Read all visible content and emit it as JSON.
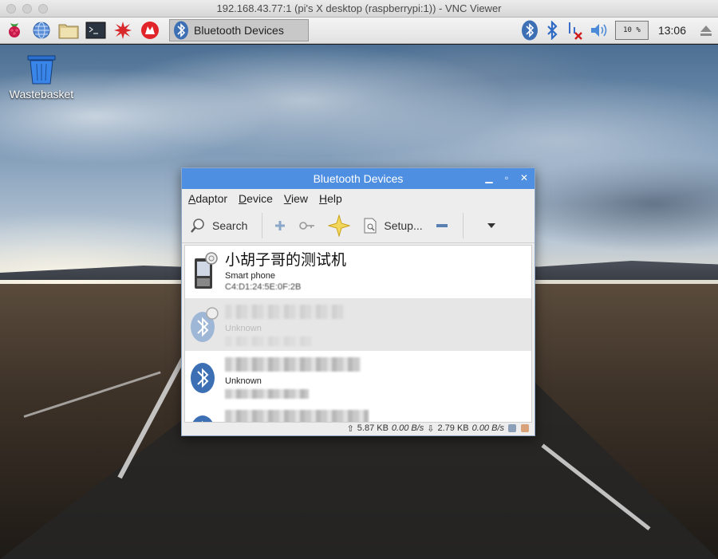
{
  "vnc": {
    "title": "192.168.43.77:1 (pi's X desktop (raspberrypi:1)) - VNC Viewer"
  },
  "panel": {
    "launchers": [
      "raspberry-menu-icon",
      "web-browser-icon",
      "file-manager-icon",
      "terminal-icon",
      "mathematica-icon",
      "wolfram-icon"
    ],
    "task": {
      "label": "Bluetooth Devices"
    },
    "tray": {
      "cpu": "10 %",
      "clock": "13:06"
    }
  },
  "desktop": {
    "icons": [
      {
        "label": "Wastebasket"
      }
    ]
  },
  "window": {
    "title": "Bluetooth Devices",
    "menu": [
      "Adaptor",
      "Device",
      "View",
      "Help"
    ],
    "toolbar": {
      "search": "Search",
      "setup": "Setup..."
    },
    "devices": [
      {
        "name": "小胡子哥的测试机",
        "type": "Smart phone",
        "address": "C4:D1:24:5E:0F:2B"
      },
      {
        "name": "",
        "type": "Unknown",
        "address": ""
      },
      {
        "name": "",
        "type": "Unknown",
        "address": ""
      },
      {
        "name": "",
        "type": "",
        "address": ""
      }
    ],
    "status": {
      "up": "5.87 KB",
      "up_rate": "0.00 B/s",
      "down": "2.79 KB",
      "down_rate": "0.00 B/s"
    }
  },
  "colors": {
    "title_bar": "#4e8fe2",
    "bluetooth_blue": "#3d6fb4"
  }
}
